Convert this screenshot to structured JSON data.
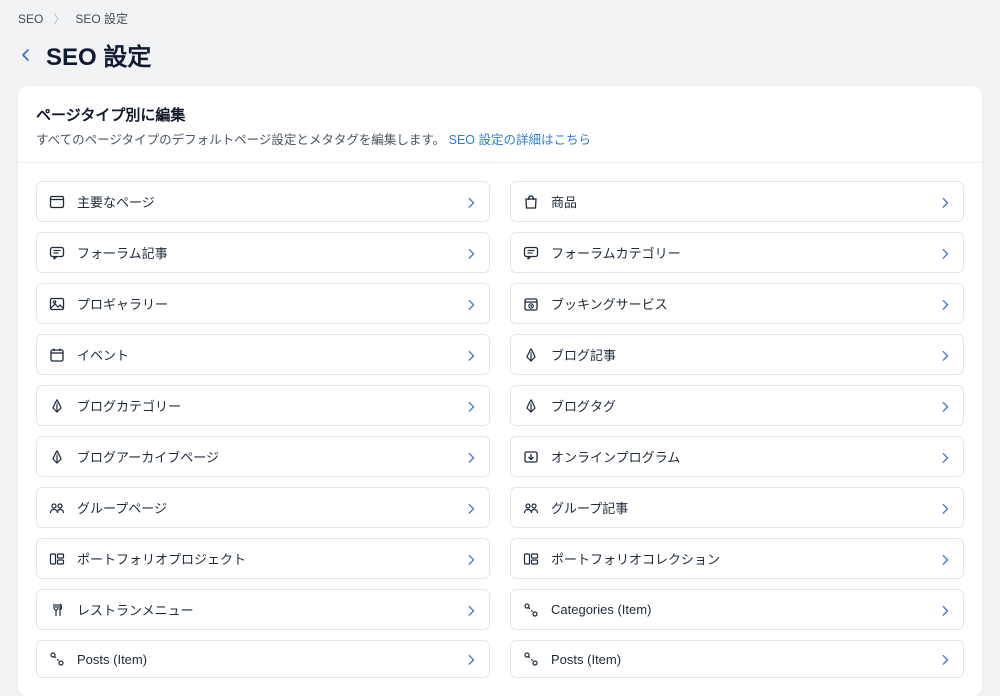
{
  "breadcrumb": {
    "items": [
      "SEO",
      "SEO 設定"
    ]
  },
  "header": {
    "title": "SEO 設定"
  },
  "section": {
    "title": "ページタイプ別に編集",
    "desc_prefix": "すべてのページタイプのデフォルトページ設定とメタタグを編集します。 ",
    "link_text": "SEO 設定の詳細はこちら"
  },
  "items_left": [
    {
      "icon": "window",
      "label": "主要なページ"
    },
    {
      "icon": "chat",
      "label": "フォーラム記事"
    },
    {
      "icon": "image",
      "label": "プロギャラリー"
    },
    {
      "icon": "calendar",
      "label": "イベント"
    },
    {
      "icon": "pen",
      "label": "ブログカテゴリー"
    },
    {
      "icon": "pen",
      "label": "ブログアーカイブページ"
    },
    {
      "icon": "group",
      "label": "グループページ"
    },
    {
      "icon": "portfolio",
      "label": "ポートフォリオプロジェクト"
    },
    {
      "icon": "fork",
      "label": "レストランメニュー"
    },
    {
      "icon": "path",
      "label": "Posts (Item)"
    }
  ],
  "items_right": [
    {
      "icon": "bag",
      "label": "商品"
    },
    {
      "icon": "chat",
      "label": "フォーラムカテゴリー"
    },
    {
      "icon": "booking",
      "label": "ブッキングサービス"
    },
    {
      "icon": "pen",
      "label": "ブログ記事"
    },
    {
      "icon": "pen",
      "label": "ブログタグ"
    },
    {
      "icon": "download",
      "label": "オンラインプログラム"
    },
    {
      "icon": "group",
      "label": "グループ記事"
    },
    {
      "icon": "portfolio",
      "label": "ポートフォリオコレクション"
    },
    {
      "icon": "path",
      "label": "Categories (Item)"
    },
    {
      "icon": "path",
      "label": "Posts (Item)"
    }
  ]
}
